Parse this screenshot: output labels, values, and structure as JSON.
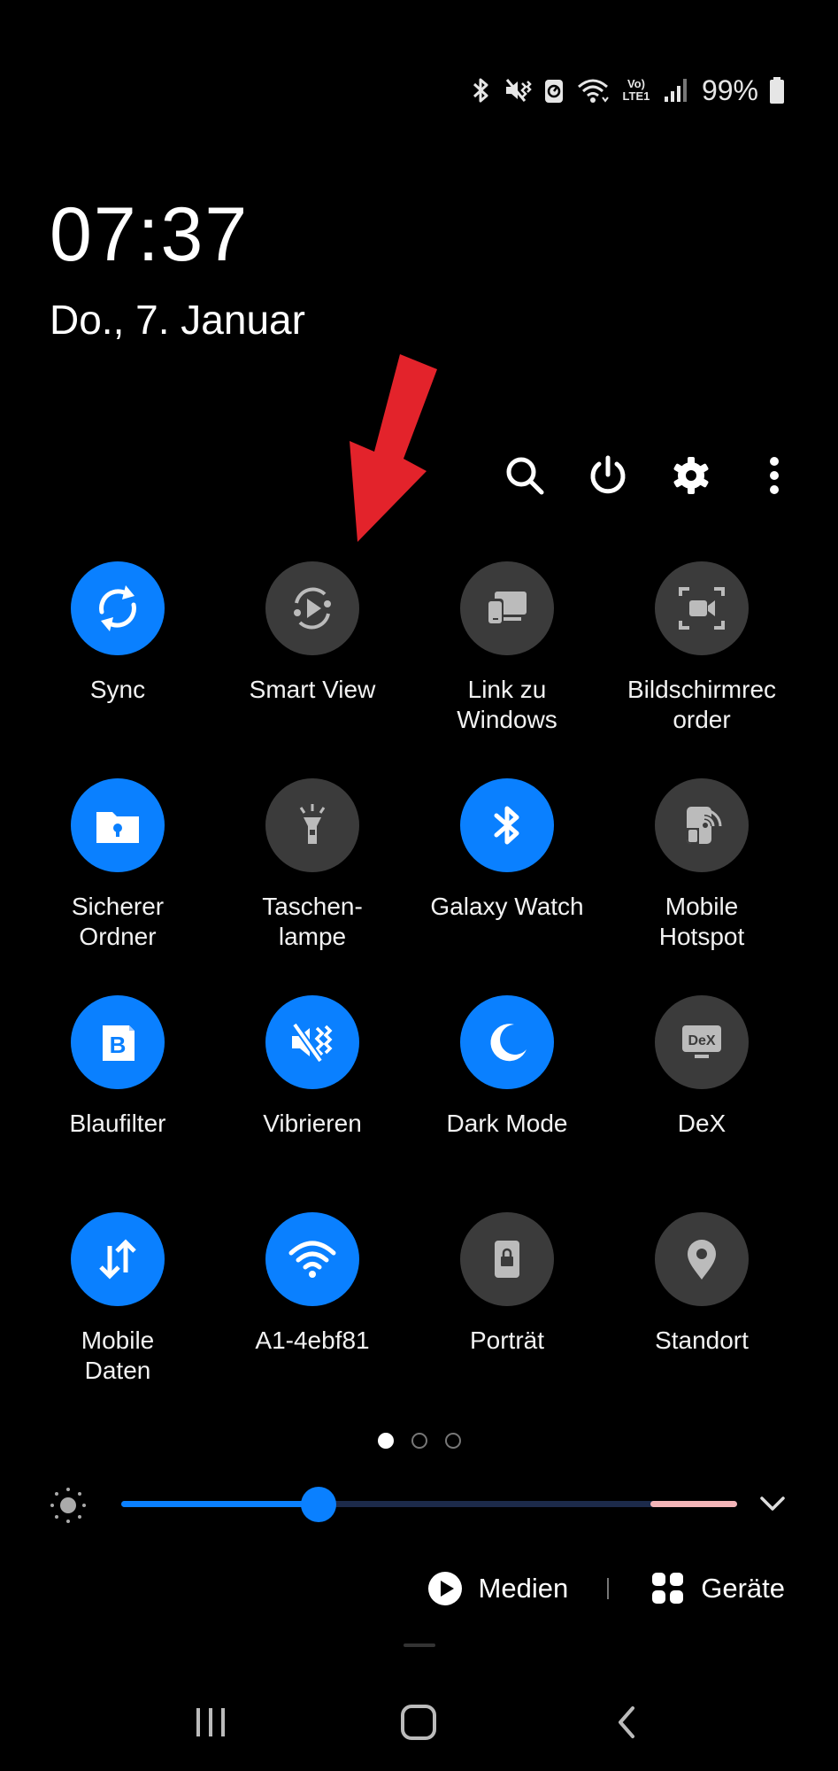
{
  "status_bar": {
    "network_label": "Vo) LTE1",
    "battery_text": "99%"
  },
  "clock": {
    "time": "07:37",
    "date": "Do., 7. Januar"
  },
  "toolbar": {
    "items": [
      "search-icon",
      "power-icon",
      "gear-icon",
      "more-vert-icon"
    ]
  },
  "tiles": [
    {
      "label": "Sync",
      "active": true,
      "icon": "sync-icon"
    },
    {
      "label": "Smart View",
      "active": false,
      "icon": "smart-view-icon"
    },
    {
      "label": "Link zu\nWindows",
      "active": false,
      "icon": "link-windows-icon"
    },
    {
      "label": "Bildschirmrec\norder",
      "active": false,
      "icon": "screen-recorder-icon"
    },
    {
      "label": "Sicherer\nOrdner",
      "active": true,
      "icon": "secure-folder-icon"
    },
    {
      "label": "Taschen-\nlampe",
      "active": false,
      "icon": "flashlight-icon"
    },
    {
      "label": "Galaxy Watch",
      "active": true,
      "icon": "bluetooth-icon"
    },
    {
      "label": "Mobile\nHotspot",
      "active": false,
      "icon": "hotspot-icon"
    },
    {
      "label": "Blaufilter",
      "active": true,
      "icon": "blue-filter-icon"
    },
    {
      "label": "Vibrieren",
      "active": true,
      "icon": "vibrate-icon"
    },
    {
      "label": "Dark Mode",
      "active": true,
      "icon": "moon-icon"
    },
    {
      "label": "DeX",
      "active": false,
      "icon": "dex-icon"
    },
    {
      "label": "Mobile\nDaten",
      "active": true,
      "icon": "mobile-data-icon"
    },
    {
      "label": "A1-4ebf81",
      "active": true,
      "icon": "wifi-icon"
    },
    {
      "label": "Porträt",
      "active": false,
      "icon": "portrait-lock-icon"
    },
    {
      "label": "Standort",
      "active": false,
      "icon": "location-icon"
    }
  ],
  "dex_icon_text": "DeX",
  "blue_filter_icon_text": "B",
  "pager": {
    "pages": 3,
    "current": 1
  },
  "brightness": {
    "level": 0.32
  },
  "media": {
    "media_label": "Medien",
    "devices_label": "Geräte"
  },
  "colors": {
    "accent": "#0a80ff",
    "inactive": "#3b3b3b",
    "arrow": "#e3232b"
  }
}
